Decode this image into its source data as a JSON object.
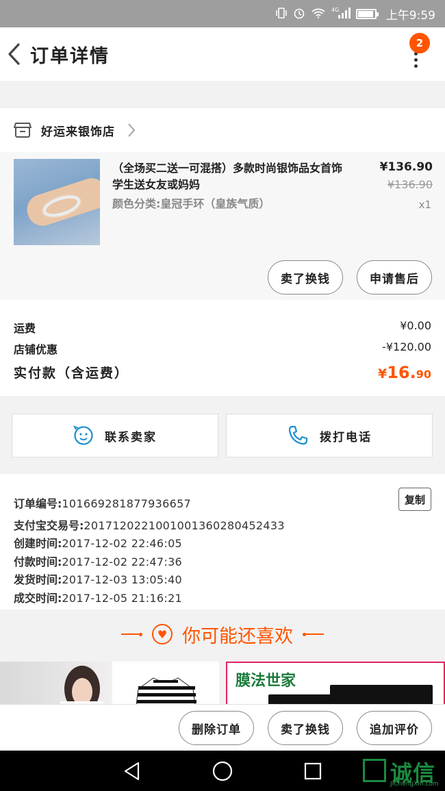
{
  "status": {
    "time": "上午9:59",
    "network": "4G"
  },
  "header": {
    "title": "订单详情",
    "badge": "2"
  },
  "shop": {
    "name": "好运来银饰店"
  },
  "product": {
    "name": "（全场买二送一可混搭）多款时尚银饰品女首饰学生送女友或妈妈",
    "sku": "颜色分类:皇冠手环（皇族气质）",
    "price": "¥136.90",
    "original_price": "¥136.90",
    "qty": "x1",
    "btn_exchange": "卖了换钱",
    "btn_aftersale": "申请售后"
  },
  "fees": {
    "shipping_label": "运费",
    "shipping_value": "¥0.00",
    "discount_label": "店铺优惠",
    "discount_value": "-¥120.00",
    "paid_label": "实付款（含运费）",
    "paid_yen": "¥",
    "paid_int": "16.",
    "paid_dec": "90"
  },
  "contact": {
    "seller": "联系卖家",
    "call": "拨打电话"
  },
  "order": {
    "copy": "复制",
    "rows": [
      {
        "label": "订单编号:",
        "value": "101669281877936657"
      },
      {
        "label": "支付宝交易号:",
        "value": "2017120221001001360280452433"
      },
      {
        "label": "创建时间:",
        "value": "2017-12-02 22:46:05"
      },
      {
        "label": "付款时间:",
        "value": "2017-12-02 22:47:36"
      },
      {
        "label": "发货时间:",
        "value": "2017-12-03 13:05:40"
      },
      {
        "label": "成交时间:",
        "value": "2017-12-05 21:16:21"
      }
    ]
  },
  "recommend": {
    "title": "你可能还喜欢",
    "brand": "膜法世家"
  },
  "bottom": {
    "delete": "删除订单",
    "exchange": "卖了换钱",
    "review": "追加评价"
  },
  "watermark": {
    "text": "诚信",
    "sub": "JiChengXin.com"
  },
  "colors": {
    "accent": "#ff5500",
    "call": "#1a8fd0"
  }
}
